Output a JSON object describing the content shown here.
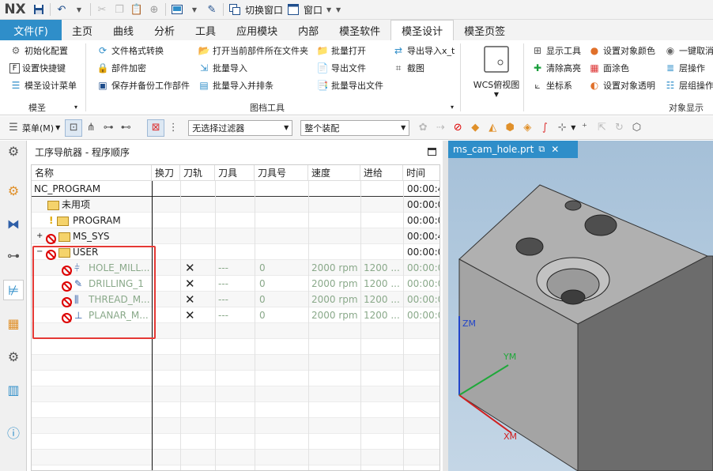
{
  "app": {
    "logo": "NX"
  },
  "quick_access": {
    "switch_window": "切换窗口",
    "window": "窗口"
  },
  "menu": {
    "file": "文件(F)",
    "tabs": [
      "主页",
      "曲线",
      "分析",
      "工具",
      "应用模块",
      "内部",
      "模圣软件",
      "模圣设计",
      "模圣页签"
    ],
    "active_tab": "模圣设计"
  },
  "ribbon": {
    "group_mosheng": {
      "label": "模圣",
      "items": [
        "初始化配置",
        "设置快捷键",
        "模圣设计菜单"
      ]
    },
    "group_drawing": {
      "label": "图档工具",
      "items": [
        "文件格式转换",
        "部件加密",
        "保存并备份工作部件",
        "打开当前部件所在文件夹",
        "批量导入",
        "批量导入并排条",
        "批量打开",
        "导出文件",
        "批量导出文件",
        "导出导入x_t",
        "截图"
      ]
    },
    "wcs_view": "WCS俯视图",
    "group_object": {
      "label": "对象显示",
      "items": [
        "显示工具",
        "设置对象颜色",
        "一键取消",
        "清除高亮",
        "面涂色",
        "层操作",
        "坐标系",
        "设置对象透明",
        "层组操作"
      ]
    }
  },
  "toolbar": {
    "menu": "菜单(M)",
    "filter": "无选择过滤器",
    "assembly": "整个装配"
  },
  "navigator": {
    "title": "工序导航器 - 程序顺序",
    "columns": [
      "名称",
      "换刀",
      "刀轨",
      "刀具",
      "刀具号",
      "速度",
      "进给",
      "时间"
    ],
    "rows": [
      {
        "name": "NC_PROGRAM",
        "time": "00:00:4"
      },
      {
        "name": "未用项",
        "time": "00:00:0"
      },
      {
        "name": "PROGRAM",
        "time": "00:00:0"
      },
      {
        "name": "MS_SYS",
        "time": "00:00:4"
      },
      {
        "name": "USER",
        "time": "00:00:0"
      },
      {
        "name": "HOLE_MILL...",
        "tool": "---",
        "toolno": "0",
        "speed": "2000 rpm",
        "feed": "1200 ...",
        "time": "00:00:0"
      },
      {
        "name": "DRILLING_1",
        "tool": "---",
        "toolno": "0",
        "speed": "2000 rpm",
        "feed": "1200 ...",
        "time": "00:00:0"
      },
      {
        "name": "THREAD_M...",
        "tool": "---",
        "toolno": "0",
        "speed": "2000 rpm",
        "feed": "1200 ...",
        "time": "00:00:0"
      },
      {
        "name": "PLANAR_M...",
        "tool": "---",
        "toolno": "0",
        "speed": "2000 rpm",
        "feed": "1200 ...",
        "time": "00:00:0"
      }
    ]
  },
  "view": {
    "tab": "ms_cam_hole.prt",
    "axes": {
      "z": "ZM",
      "y": "YM",
      "x": "XM"
    }
  },
  "colors": {
    "accent": "#2f8ec9",
    "part": "#9a9a9a",
    "error": "#e53935"
  }
}
